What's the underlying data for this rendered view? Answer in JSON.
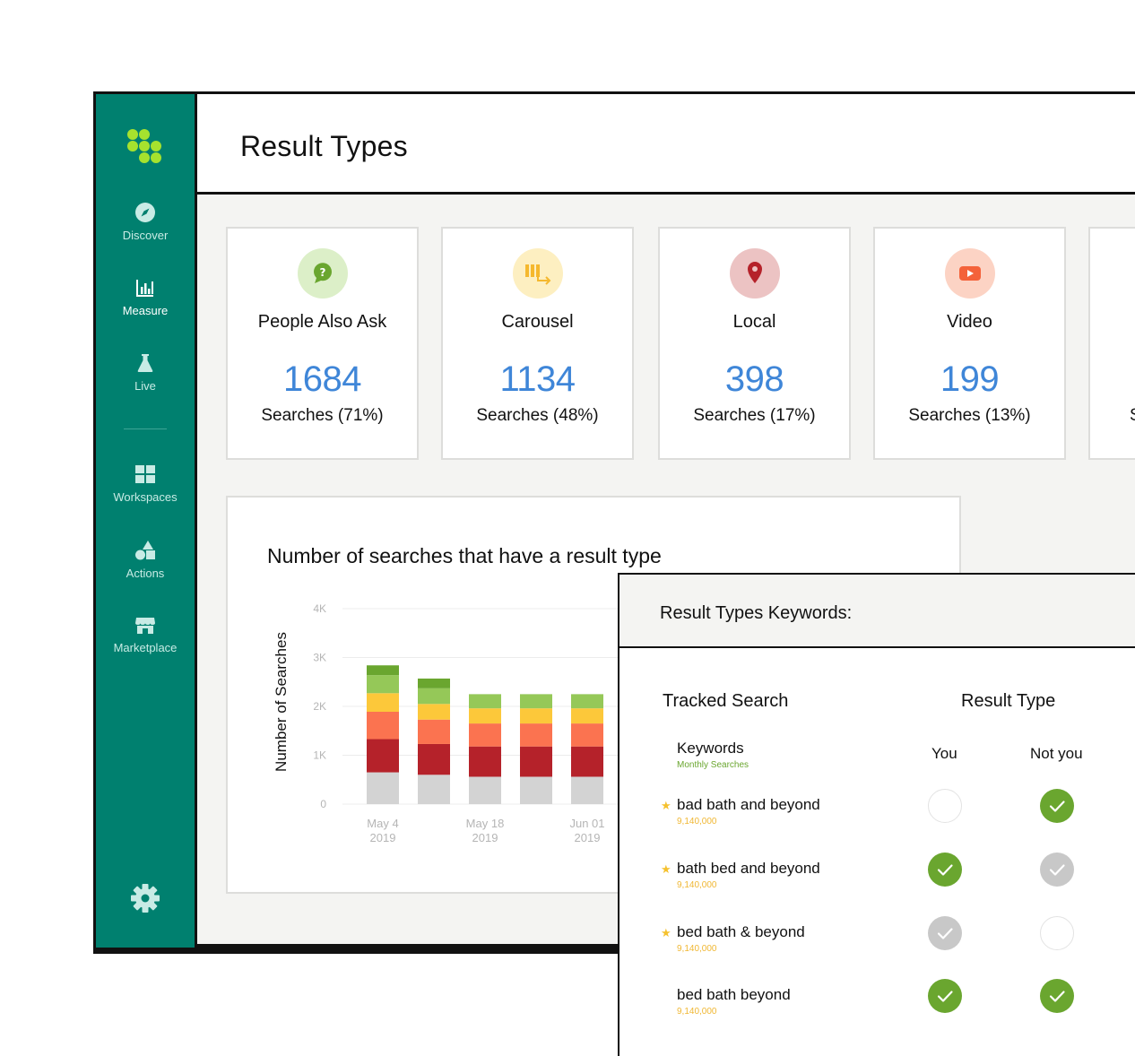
{
  "page": {
    "title": "Result Types"
  },
  "sidebar": {
    "items": [
      {
        "label": "Discover",
        "icon": "compass-icon"
      },
      {
        "label": "Measure",
        "icon": "bar-chart-icon"
      },
      {
        "label": "Live",
        "icon": "flask-icon"
      },
      {
        "label": "Workspaces",
        "icon": "grid-icon"
      },
      {
        "label": "Actions",
        "icon": "shapes-icon"
      },
      {
        "label": "Marketplace",
        "icon": "store-icon"
      }
    ],
    "active": "Measure",
    "settings_icon": "gear-icon",
    "accent": "#00806f",
    "logo_color": "#a6e22e"
  },
  "cards": [
    {
      "label": "People Also Ask",
      "value": "1684",
      "sub": "Searches (71%)",
      "icon": "question-bubble-icon",
      "icon_bg": "#dcefc8",
      "icon_fg": "#6aa62f"
    },
    {
      "label": "Carousel",
      "value": "1134",
      "sub": "Searches (48%)",
      "icon": "carousel-icon",
      "icon_bg": "#fdefc1",
      "icon_fg": "#f5b82e"
    },
    {
      "label": "Local",
      "value": "398",
      "sub": "Searches (17%)",
      "icon": "map-pin-icon",
      "icon_bg": "#ecc3c3",
      "icon_fg": "#b5222a"
    },
    {
      "label": "Video",
      "value": "199",
      "sub": "Searches (13%)",
      "icon": "play-icon",
      "icon_bg": "#fcd3c4",
      "icon_fg": "#f4623a"
    },
    {
      "label": "",
      "value": "",
      "sub": "S",
      "icon": "",
      "icon_bg": "#ffffff",
      "icon_fg": "#111111"
    }
  ],
  "chart_data": {
    "type": "bar",
    "stacked": true,
    "title": "Number of searches that have a result type",
    "ylabel": "Number of Searches",
    "xlabel": "",
    "ylim": [
      0,
      4000
    ],
    "y_ticks": [
      "0",
      "1K",
      "2K",
      "3K",
      "4K"
    ],
    "x_tick_labels": [
      {
        "line1": "May 4",
        "line2": "2019",
        "index": 0
      },
      {
        "line1": "May 18",
        "line2": "2019",
        "index": 2
      },
      {
        "line1": "Jun 01",
        "line2": "2019",
        "index": 4
      }
    ],
    "grid": true,
    "colors": [
      "#d3d3d3",
      "#b5222a",
      "#fb7350",
      "#fcc83a",
      "#95c858",
      "#6aa62f"
    ],
    "stacks": [
      [
        650,
        680,
        560,
        380,
        370,
        200
      ],
      [
        600,
        630,
        500,
        320,
        320,
        200
      ],
      [
        560,
        620,
        470,
        310,
        290,
        0
      ],
      [
        560,
        620,
        470,
        310,
        290,
        0
      ],
      [
        560,
        620,
        470,
        310,
        290,
        0
      ]
    ]
  },
  "keywords_panel": {
    "title": "Result Types Keywords:",
    "col_tracked": "Tracked Search",
    "col_result": "Result Type",
    "sub_keywords": "Keywords",
    "sub_hint": "Monthly Searches",
    "sub_you": "You",
    "sub_notyou": "Not you",
    "rows": [
      {
        "name": "bad bath and beyond",
        "volume": "9,140,000",
        "star": "★",
        "you": "empty",
        "notyou": "green"
      },
      {
        "name": "bath bed and beyond",
        "volume": "9,140,000",
        "star": "★",
        "you": "green",
        "notyou": "gray"
      },
      {
        "name": "bed bath & beyond",
        "volume": "9,140,000",
        "star": "★",
        "you": "gray",
        "notyou": "empty"
      },
      {
        "name": "bed bath beyond",
        "volume": "9,140,000",
        "star": "",
        "you": "green",
        "notyou": "green"
      }
    ]
  }
}
